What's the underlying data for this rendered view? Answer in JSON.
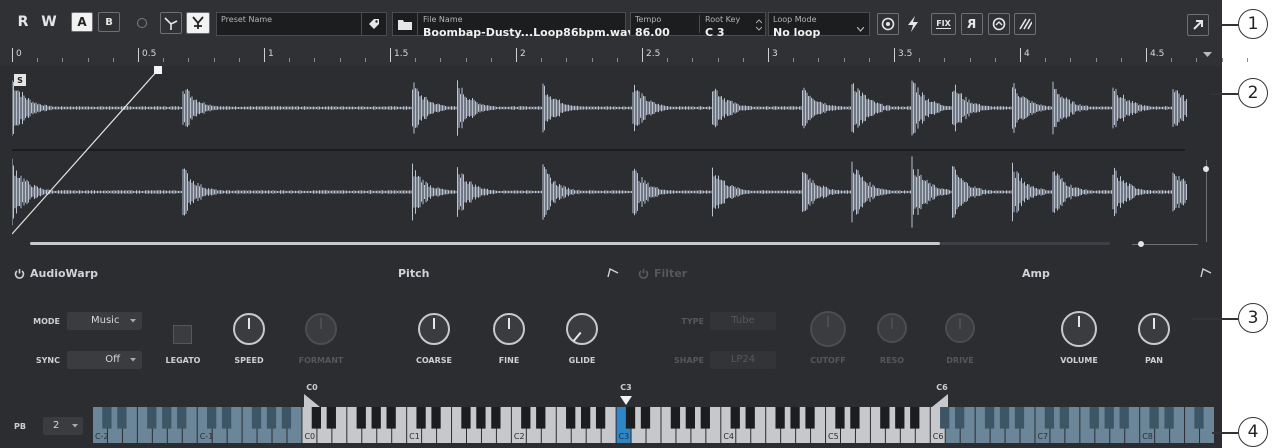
{
  "toolbar": {
    "read": "R",
    "write": "W",
    "slot_a": "A",
    "slot_b": "B",
    "preset_label": "Preset Name",
    "preset_value": "",
    "file_label": "File Name",
    "file_value": "Boombap-Dusty...Loop86bpm.wav",
    "tempo_label": "Tempo",
    "tempo_value": "86.00",
    "rootkey_label": "Root Key",
    "rootkey_value": "C 3",
    "loopmode_label": "Loop Mode",
    "loopmode_value": "No loop",
    "fix_label": "FIX",
    "reverse_label": "R"
  },
  "ruler": {
    "marks": [
      "0",
      "0.5",
      "1",
      "1.5",
      "2",
      "2.5",
      "3",
      "3.5",
      "4",
      "4.5"
    ],
    "start_marker": "S"
  },
  "sections": {
    "audiowarp": "AudioWarp",
    "pitch": "Pitch",
    "filter": "Filter",
    "amp": "Amp"
  },
  "audiowarp": {
    "mode_label": "MODE",
    "mode_value": "Music",
    "sync_label": "SYNC",
    "sync_value": "Off",
    "legato": "LEGATO",
    "speed": "SPEED",
    "formant": "FORMANT"
  },
  "pitch": {
    "coarse": "COARSE",
    "fine": "FINE",
    "glide": "GLIDE"
  },
  "filter": {
    "type_label": "TYPE",
    "type_value": "Tube",
    "shape_label": "SHAPE",
    "shape_value": "LP24",
    "cutoff": "CUTOFF",
    "reso": "RESO",
    "drive": "DRIVE"
  },
  "amp": {
    "volume": "VOLUME",
    "pan": "PAN"
  },
  "keyboard": {
    "pb_label": "PB",
    "pb_value": "2",
    "range_low": "C0",
    "root": "C3",
    "range_high": "C6",
    "octave_labels": [
      "C-2",
      "C-1",
      "C0",
      "C1",
      "C2",
      "C3",
      "C4",
      "C5",
      "C6",
      "C7",
      "C8"
    ]
  },
  "callouts": [
    "1",
    "2",
    "3",
    "4"
  ],
  "colors": {
    "background": "#2b2d30",
    "waveform": "#b9c3d2",
    "active_key": "#2f86c4",
    "range_key": "#c6c8cb",
    "outside_key": "#6b8699"
  }
}
